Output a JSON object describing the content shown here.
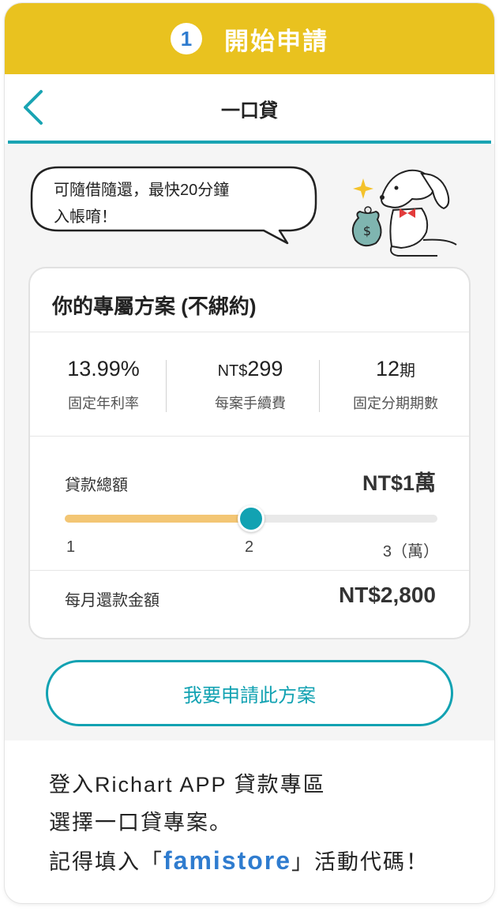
{
  "banner": {
    "step_number": "1",
    "title": "開始申請",
    "color": "#e9c21f"
  },
  "nav": {
    "back_icon": "chevron-left-icon",
    "title": "一口貸"
  },
  "speech_bubble": {
    "line1": "可隨借隨還，最快20分鐘",
    "line2": "入帳唷！"
  },
  "card": {
    "title": "你的專屬方案 (不綁約)",
    "stats": [
      {
        "value": "13.99%",
        "label": "固定年利率"
      },
      {
        "prefix": "NT$",
        "value": "299",
        "label": "每案手續費"
      },
      {
        "value": "12",
        "suffix": "期",
        "label": "固定分期期數"
      }
    ],
    "loan": {
      "label": "貸款總額",
      "value": "NT$1萬",
      "slider": {
        "min": 1,
        "max": 3,
        "current": 2,
        "fill_fraction": 0.5
      },
      "ticks": [
        "1",
        "2",
        "3（萬）"
      ]
    },
    "monthly": {
      "label": "每月還款金額",
      "value": "NT$2,800"
    }
  },
  "apply_button": {
    "label": "我要申請此方案"
  },
  "instructions": {
    "line1": "登入Richart APP 貸款專區",
    "line2": "選擇一口貸專案。",
    "line3_prefix": "記得填入「",
    "promo_code": "famistore",
    "line3_suffix": "」活動代碼！"
  },
  "colors": {
    "accent": "#12a2b2",
    "slider_fill": "#f3c674",
    "promo": "#2f7ccf"
  }
}
